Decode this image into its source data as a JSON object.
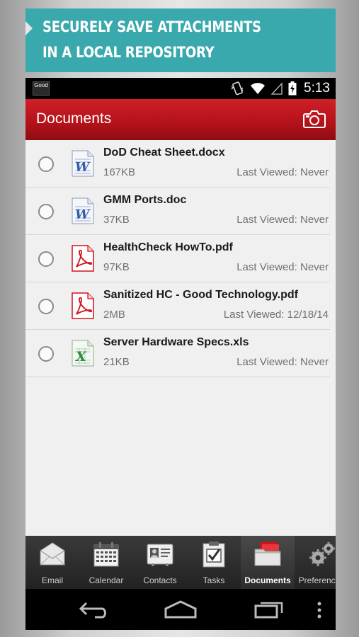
{
  "banner": {
    "line1": "SECURELY SAVE ATTACHMENTS",
    "line2": "IN A LOCAL REPOSITORY"
  },
  "statusbar": {
    "badge": "Good",
    "time": "5:13"
  },
  "appbar": {
    "title": "Documents",
    "camera_icon": "camera-icon"
  },
  "documents": [
    {
      "name": "DoD Cheat Sheet.docx",
      "size": "167KB",
      "viewed": "Last Viewed: Never",
      "type": "word"
    },
    {
      "name": "GMM Ports.doc",
      "size": "37KB",
      "viewed": "Last Viewed: Never",
      "type": "word"
    },
    {
      "name": "HealthCheck HowTo.pdf",
      "size": "97KB",
      "viewed": "Last Viewed: Never",
      "type": "pdf"
    },
    {
      "name": "Sanitized HC - Good Technology.pdf",
      "size": "2MB",
      "viewed": "Last Viewed: 12/18/14",
      "type": "pdf"
    },
    {
      "name": "Server Hardware Specs.xls",
      "size": "21KB",
      "viewed": "Last Viewed: Never",
      "type": "excel"
    }
  ],
  "tabs": [
    {
      "label": "Email",
      "icon": "email-icon"
    },
    {
      "label": "Calendar",
      "icon": "calendar-icon"
    },
    {
      "label": "Contacts",
      "icon": "contacts-icon"
    },
    {
      "label": "Tasks",
      "icon": "tasks-icon"
    },
    {
      "label": "Documents",
      "icon": "documents-icon",
      "active": true
    },
    {
      "label": "Preferences",
      "icon": "preferences-icon"
    }
  ],
  "colors": {
    "banner": "#3aa9ad",
    "appbar": "#c4161e",
    "word": "#2f5fa8",
    "pdf": "#d2121a",
    "excel": "#2e8a3a"
  }
}
